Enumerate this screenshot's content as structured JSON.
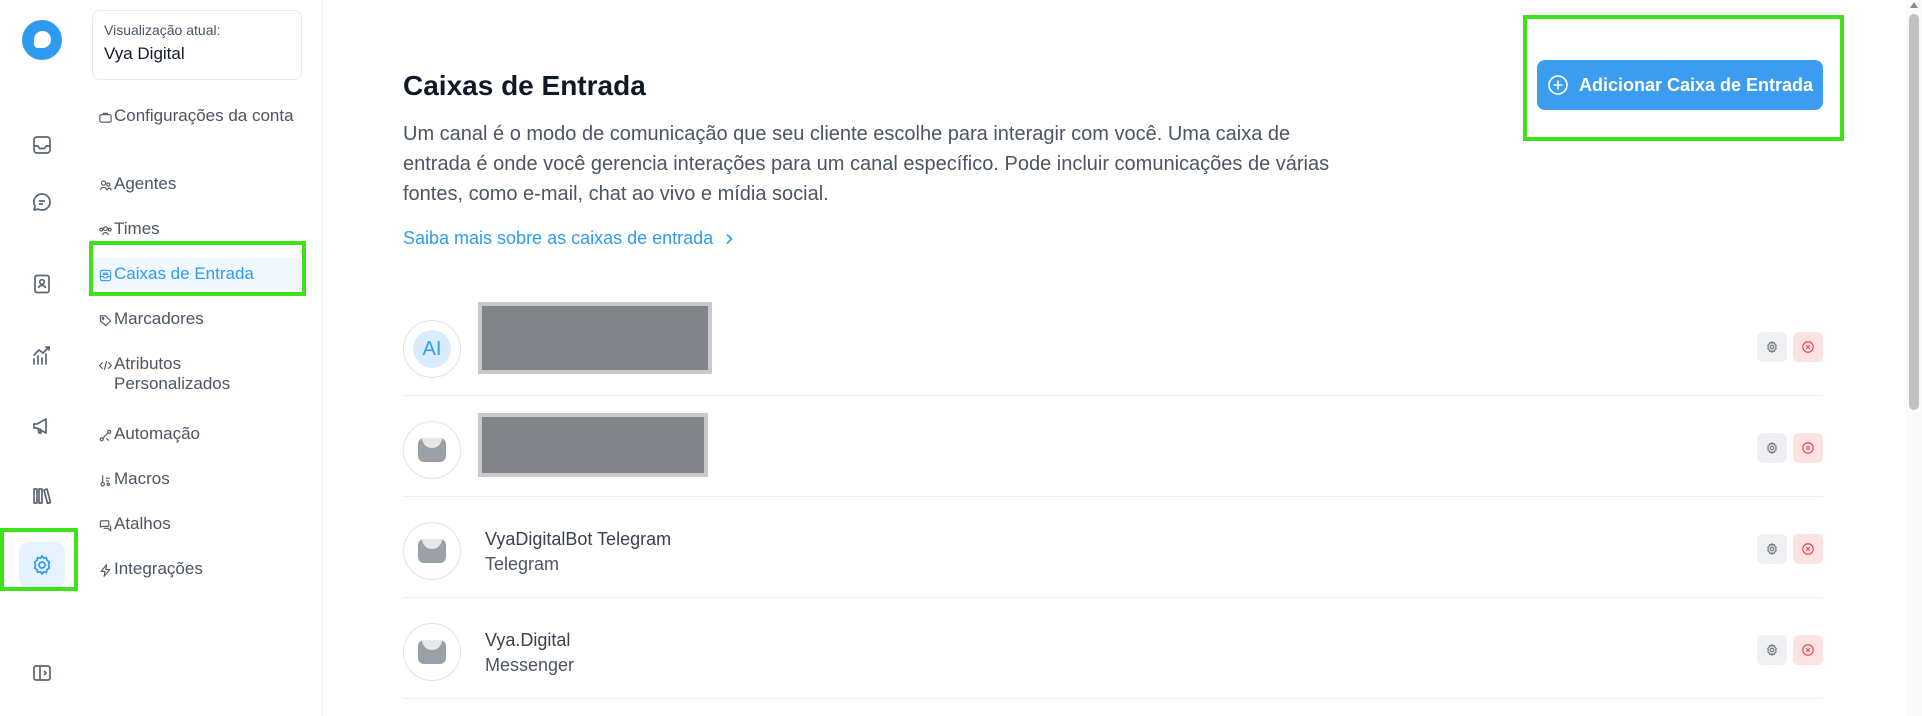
{
  "sidebar": {
    "account_caption": "Visualização atual:",
    "account_name": "Vya Digital",
    "items": [
      {
        "label": "Configurações da conta",
        "icon": "briefcase-icon"
      },
      {
        "label": "Agentes",
        "icon": "users-icon"
      },
      {
        "label": "Times",
        "icon": "people-group-icon"
      },
      {
        "label": "Caixas de Entrada",
        "icon": "inbox-icon",
        "active": true
      },
      {
        "label": "Marcadores",
        "icon": "tag-icon"
      },
      {
        "label": "Atributos Personalizados",
        "icon": "code-icon"
      },
      {
        "label": "Automação",
        "icon": "automation-icon"
      },
      {
        "label": "Macros",
        "icon": "macros-icon"
      },
      {
        "label": "Atalhos",
        "icon": "chat-bubbles-icon"
      },
      {
        "label": "Integrações",
        "icon": "lightning-icon"
      }
    ]
  },
  "rail": {
    "icons": [
      "inbox-icon",
      "chat-icon",
      "contacts-icon",
      "reports-icon",
      "campaigns-icon",
      "library-icon",
      "settings-icon",
      "sidebar-toggle-icon"
    ],
    "active": "settings-icon"
  },
  "main": {
    "title": "Caixas de Entrada",
    "description": "Um canal é o modo de comunicação que seu cliente escolhe para interagir com você. Uma caixa de entrada é onde você gerencia interações para um canal específico. Pode incluir comunicações de várias fontes, como e-mail, chat ao vivo e mídia social.",
    "learn_more": "Saiba mais sobre as caixas de entrada",
    "add_button": "Adicionar Caixa de Entrada"
  },
  "inboxes": [
    {
      "avatar": "AI",
      "name": "",
      "channel": "",
      "redacted": true
    },
    {
      "avatar": "inbox-tray-icon",
      "name": "",
      "channel": "",
      "redacted": true
    },
    {
      "avatar": "inbox-tray-icon",
      "name": "VyaDigitalBot Telegram",
      "channel": "Telegram"
    },
    {
      "avatar": "inbox-tray-icon",
      "name": "Vya.Digital",
      "channel": "Messenger"
    }
  ],
  "colors": {
    "accent": "#2f9bf0",
    "button": "#3b9cf0",
    "highlight": "#3ee21a",
    "delete": "#e5484d"
  }
}
